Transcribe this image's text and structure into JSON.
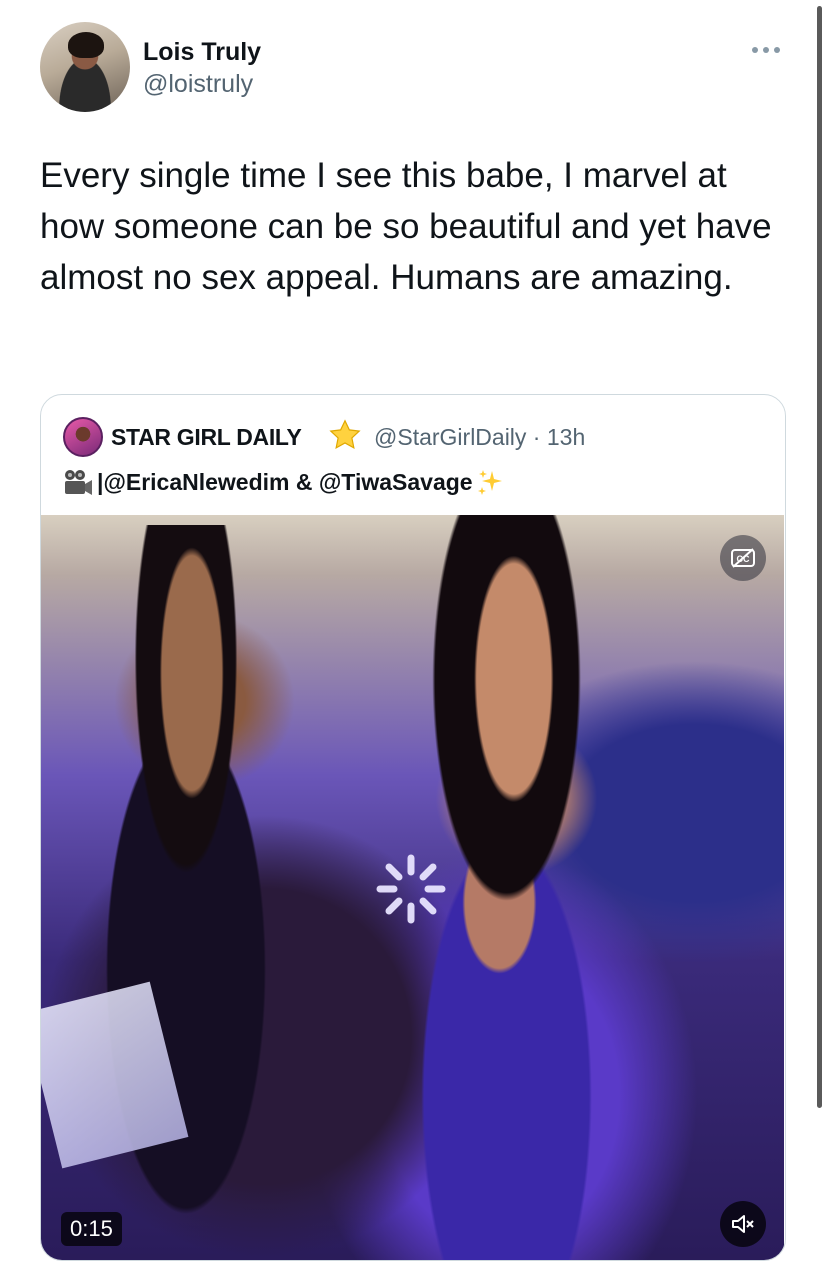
{
  "tweet": {
    "author": {
      "name": "Lois Truly",
      "handle": "@loistruly",
      "avatar_icon": "profile-photo"
    },
    "more_icon": "more-horizontal-icon",
    "text": "Every single time I see this babe, I marvel at how someone can be so beautiful and yet have almost no sex appeal. Humans are amazing."
  },
  "quote": {
    "author": {
      "name": "STAR GIRL DAILY",
      "name_emoji": "star-icon",
      "handle": "@StarGirlDaily",
      "time": " · 13h"
    },
    "body": {
      "prefix_icon": "movie-camera-icon",
      "separator": "| ",
      "text": "@EricaNlewedim & @TiwaSavage",
      "suffix_icon": "sparkles-icon"
    },
    "video": {
      "duration": "0:15",
      "cc_icon": "closed-captions-off-icon",
      "mute_icon": "speaker-muted-icon",
      "loading_icon": "loading-spinner-icon"
    }
  },
  "colors": {
    "text": "#0f1419",
    "secondary": "#536471",
    "border": "#cfd9de"
  }
}
